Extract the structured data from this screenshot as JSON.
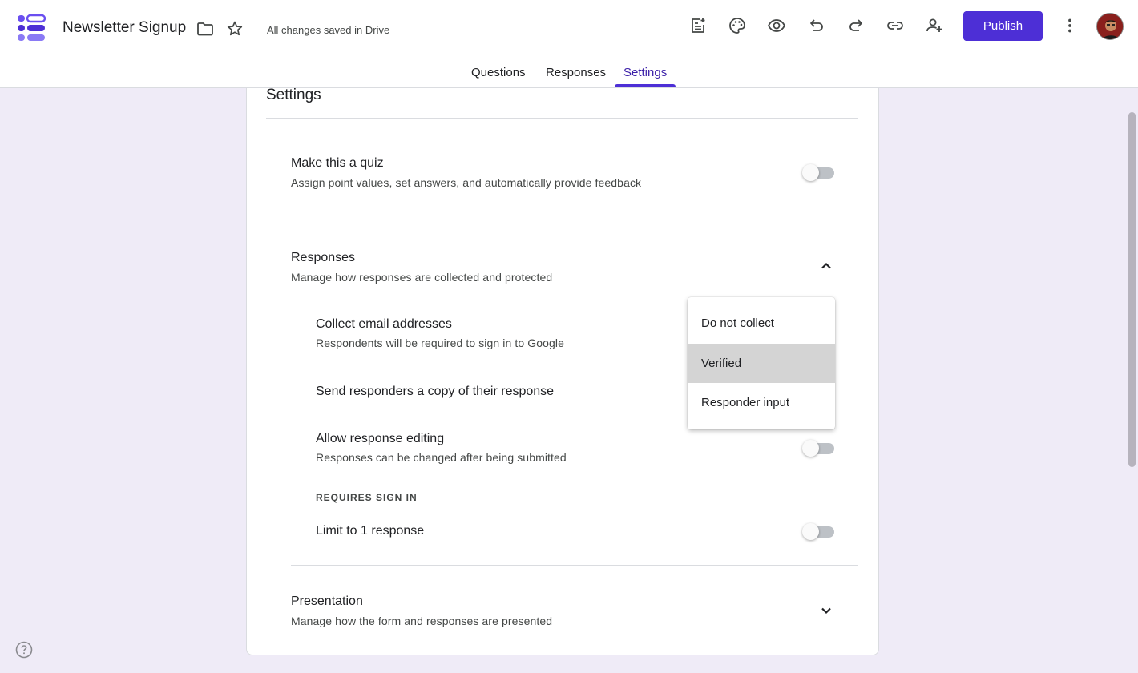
{
  "header": {
    "title": "Newsletter Signup",
    "saved_status": "All changes saved in Drive",
    "publish_label": "Publish"
  },
  "tabs": [
    {
      "label": "Questions",
      "active": false
    },
    {
      "label": "Responses",
      "active": false
    },
    {
      "label": "Settings",
      "active": true
    }
  ],
  "settings": {
    "title": "Settings",
    "quiz": {
      "title": "Make this a quiz",
      "subtitle": "Assign point values, set answers, and automatically provide feedback",
      "enabled": false
    },
    "responses": {
      "title": "Responses",
      "subtitle": "Manage how responses are collected and protected",
      "expanded": true,
      "collect_email": {
        "title": "Collect email addresses",
        "subtitle": "Respondents will be required to sign in to Google",
        "options": [
          "Do not collect",
          "Verified",
          "Responder input"
        ],
        "selected": "Verified"
      },
      "send_copy": {
        "title": "Send responders a copy of their response"
      },
      "allow_editing": {
        "title": "Allow response editing",
        "subtitle": "Responses can be changed after being submitted",
        "enabled": false
      },
      "requires_sign_in_label": "REQUIRES SIGN IN",
      "limit_one": {
        "title": "Limit to 1 response",
        "enabled": false
      }
    },
    "presentation": {
      "title": "Presentation",
      "subtitle": "Manage how the form and responses are presented",
      "expanded": false
    }
  },
  "colors": {
    "accent": "#4d2fd6",
    "background": "#efebf7"
  }
}
